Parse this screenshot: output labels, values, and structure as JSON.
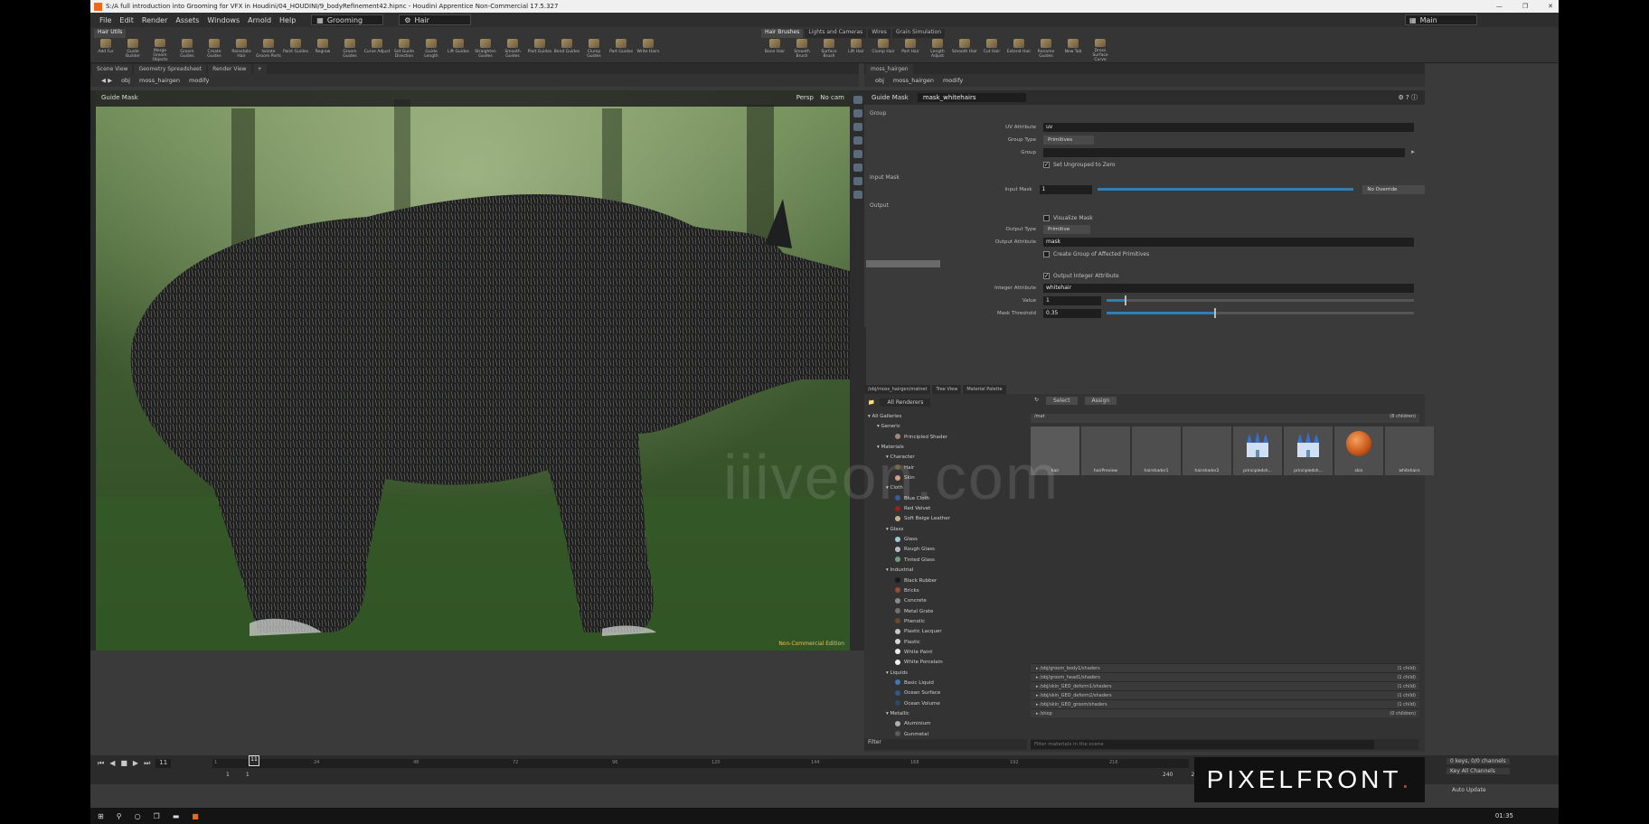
{
  "window": {
    "title": "S:/A full introduction into Grooming for VFX in Houdini/04_HOUDINI/9_bodyRefinement42.hipnc - Houdini Apprentice Non-Commercial 17.5.327",
    "controls": [
      "—",
      "❐",
      "✕"
    ]
  },
  "menubar": {
    "items": [
      "File",
      "Edit",
      "Render",
      "Assets",
      "Windows",
      "Arnold",
      "Help"
    ],
    "desktop": "Grooming",
    "context": "Hair",
    "right": "Main"
  },
  "shelf_left": {
    "tabs": [
      "Hair Utils"
    ],
    "tools": [
      "Add Fur",
      "Guide Builder",
      "Merge Groom Objects",
      "Groom Guides",
      "Create Guides",
      "Reinstate Hair",
      "Isolate Groom Parts",
      "Paint Guides",
      "Regrow",
      "Groom Guides",
      "Curve Adjust",
      "Set Guide Direction",
      "Guide Length",
      "Lift Guides",
      "Straighten Guides",
      "Smooth Guides",
      "Plait Guides",
      "Bend Guides",
      "Clump Guides",
      "Part Guides",
      "Write Hairs"
    ]
  },
  "shelf_right": {
    "tabs": [
      "Hair Brushes",
      "Lights and Cameras",
      "Wires",
      "Grain Simulation"
    ],
    "tools": [
      "Bone Hair",
      "Smooth Brush",
      "Surface Brush",
      "Lift Hair",
      "Clump Hair",
      "Part Hair",
      "Length Adjust",
      "Smooth Hair",
      "Cut Hair",
      "Extend Hair",
      "Rename Guides",
      "New Tab",
      "Dress Surface Curve"
    ]
  },
  "viewport": {
    "tabs": [
      "Scene View",
      "Geometry Spreadsheet",
      "Render View"
    ],
    "path": [
      "obj",
      "moss_hairgen",
      "modify"
    ],
    "title": "Guide Mask",
    "corner_labels": [
      "Persp",
      "No cam"
    ],
    "status": "Non-Commercial Edition",
    "watermark": "iiiveon.com"
  },
  "params": {
    "tabs": [
      "moss_hairgen",
      "obj",
      "moss_hairgen",
      "modify"
    ],
    "node_type": "Guide Mask",
    "node_name": "mask_whitehairs",
    "sections": {
      "group": "Group",
      "input_mask": "Input Mask",
      "output": "Output"
    },
    "uv_attribute_label": "UV Attribute",
    "uv_attribute": "uv",
    "group_type_label": "Group Type",
    "group_type": "Primitives",
    "group_label": "Group",
    "set_ungrouped_label": "Set Ungrouped to Zero",
    "input_mask_label": "Input Mask",
    "input_mask_value": "1",
    "input_mask_override": "No Override",
    "visualize_label": "Visualize Mask",
    "output_type_label": "Output Type",
    "output_type": "Primitive",
    "output_attribute_label": "Output Attribute",
    "output_attribute": "mask",
    "create_group_label": "Create Group of Affected Primitives",
    "output_integer_label": "Output Integer Attribute",
    "integer_attribute_label": "Integer Attribute",
    "integer_attribute": "whitehair",
    "value_label": "Value",
    "value": "1",
    "value_fraction": 0.06,
    "threshold_label": "Mask Threshold",
    "threshold": "0.35",
    "threshold_fraction": 0.35
  },
  "material_palette": {
    "tabs": [
      "/obj/moss_hairgen/matnet",
      "Tree View",
      "Material Palette"
    ],
    "renderer": "All Renderers",
    "select_btn": "Select",
    "assign_btn": "Assign",
    "tree": [
      {
        "label": "All Galleries",
        "indent": 0
      },
      {
        "label": "Generic",
        "indent": 1
      },
      {
        "label": "Principled Shader",
        "indent": 3,
        "swatch": "#a08878"
      },
      {
        "label": "Materials",
        "indent": 1
      },
      {
        "label": "Character",
        "indent": 2
      },
      {
        "label": "Hair",
        "indent": 3,
        "swatch": "#6a5236"
      },
      {
        "label": "Skin",
        "indent": 3,
        "swatch": "#d6a080"
      },
      {
        "label": "Cloth",
        "indent": 2
      },
      {
        "label": "Blue Cloth",
        "indent": 3,
        "swatch": "#3a5a9a"
      },
      {
        "label": "Red Velvet",
        "indent": 3,
        "swatch": "#9a2020"
      },
      {
        "label": "Soft Beige Leather",
        "indent": 3,
        "swatch": "#c8b08a"
      },
      {
        "label": "Glass",
        "indent": 2
      },
      {
        "label": "Glass",
        "indent": 3,
        "swatch": "#a0c8d8"
      },
      {
        "label": "Rough Glass",
        "indent": 3,
        "swatch": "#b0c0c8"
      },
      {
        "label": "Tinted Glass",
        "indent": 3,
        "swatch": "#6aa088"
      },
      {
        "label": "Industrial",
        "indent": 2
      },
      {
        "label": "Black Rubber",
        "indent": 3,
        "swatch": "#1a1a1a"
      },
      {
        "label": "Bricks",
        "indent": 3,
        "swatch": "#9a4a30"
      },
      {
        "label": "Concrete",
        "indent": 3,
        "swatch": "#8a8a8a"
      },
      {
        "label": "Metal Grate",
        "indent": 3,
        "swatch": "#707070"
      },
      {
        "label": "Phenolic",
        "indent": 3,
        "swatch": "#6a4a2a"
      },
      {
        "label": "Plastic Lacquer",
        "indent": 3,
        "swatch": "#c8c8c8"
      },
      {
        "label": "Plastic",
        "indent": 3,
        "swatch": "#d8d8d8"
      },
      {
        "label": "White Paint",
        "indent": 3,
        "swatch": "#eeeeee"
      },
      {
        "label": "White Porcelain",
        "indent": 3,
        "swatch": "#f0f0f0"
      },
      {
        "label": "Liquids",
        "indent": 2
      },
      {
        "label": "Basic Liquid",
        "indent": 3,
        "swatch": "#3a7ab8"
      },
      {
        "label": "Ocean Surface",
        "indent": 3,
        "swatch": "#2a5a8a"
      },
      {
        "label": "Ocean Volume",
        "indent": 3,
        "swatch": "#2a4a6a"
      },
      {
        "label": "Metallic",
        "indent": 2
      },
      {
        "label": "Aluminium",
        "indent": 3,
        "swatch": "#b0b0b0"
      },
      {
        "label": "Gunmetal",
        "indent": 3,
        "swatch": "#5a5a5a"
      }
    ],
    "filter_label": "Filter",
    "filter_placeholder": "Filter materials in the scene",
    "group_header": "/mat",
    "group_count": "(8 children)",
    "thumbs": [
      "hair",
      "hairPreview",
      "hairshader1",
      "hairshader2",
      "principledsh...",
      "principledsh...",
      "skin",
      "whitehairs"
    ],
    "libraries": [
      {
        "path": "/obj/groom_body1/shaders",
        "count": "(1 child)"
      },
      {
        "path": "/obj/groom_head1/shaders",
        "count": "(1 child)"
      },
      {
        "path": "/obj/skin_GEO_deform1/shaders",
        "count": "(1 child)"
      },
      {
        "path": "/obj/skin_GEO_deform2/shaders",
        "count": "(1 child)"
      },
      {
        "path": "/obj/skin_GEO_groom/shaders",
        "count": "(1 child)"
      },
      {
        "path": "/shop",
        "count": "(0 children)"
      }
    ]
  },
  "timeline": {
    "frame": "11",
    "start": "1",
    "start2": "1",
    "end": "240",
    "end2": "240",
    "ticks": [
      "1",
      "24",
      "48",
      "72",
      "96",
      "120",
      "144",
      "168",
      "192",
      "216"
    ],
    "keys": "0 keys, 0/0 channels",
    "key_all": "Key All Channels",
    "auto_update": "Auto Update"
  },
  "taskbar": {
    "time": "01:35"
  },
  "overlay": {
    "logo": "PIXELFRONT",
    "logo_dot": "."
  }
}
